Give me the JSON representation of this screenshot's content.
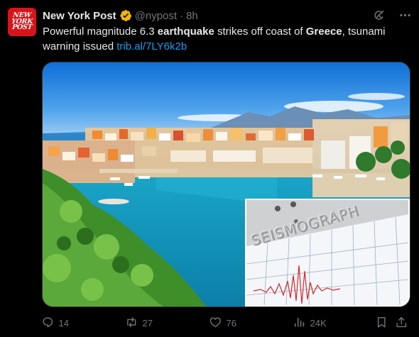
{
  "account": {
    "name": "New York Post",
    "handle": "@nypost",
    "time": "8h",
    "avatar_text": [
      "NEW",
      "YORK",
      "POST"
    ]
  },
  "tweet": {
    "t1": "Powerful magnitude 6.3 ",
    "b1": "earthquake",
    "t2": " strikes off coast of ",
    "b2": "Greece",
    "t3": ", tsunami warning issued ",
    "link": "trib.al/7LY6k2b"
  },
  "media": {
    "inset_label": "SEISMOGRAPH"
  },
  "actions": {
    "replies": "14",
    "reposts": "27",
    "likes": "76",
    "views": "24K"
  },
  "icons": [
    "verified-icon",
    "grok-icon",
    "more-icon",
    "reply-icon",
    "repost-icon",
    "like-icon",
    "views-icon",
    "bookmark-icon",
    "share-icon"
  ],
  "colors": {
    "link": "#1d9bf0",
    "verified": "#f4b400",
    "muted": "#71767b",
    "brand": "#d7141a"
  }
}
